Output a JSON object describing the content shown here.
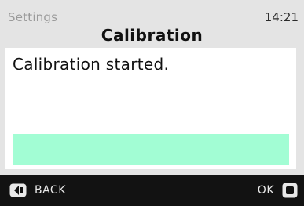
{
  "status_bar": {
    "title": "Settings",
    "time": "14:21"
  },
  "page": {
    "title": "Calibration"
  },
  "content": {
    "message": "Calibration started.",
    "progress": 1.0,
    "progress_color": "#a2fdd4"
  },
  "softkeys": {
    "back_label": "BACK",
    "back_icon": "back-key-icon",
    "ok_label": "OK",
    "ok_icon": "ok-key-icon"
  }
}
